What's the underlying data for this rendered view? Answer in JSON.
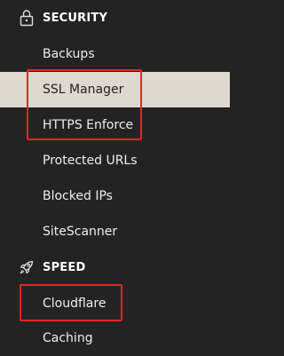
{
  "sidebar": {
    "sections": [
      {
        "title": "SECURITY",
        "icon": "lock-icon",
        "items": [
          {
            "label": "Backups",
            "active": false
          },
          {
            "label": "SSL Manager",
            "active": true
          },
          {
            "label": "HTTPS Enforce",
            "active": false
          },
          {
            "label": "Protected URLs",
            "active": false
          },
          {
            "label": "Blocked IPs",
            "active": false
          },
          {
            "label": "SiteScanner",
            "active": false
          }
        ]
      },
      {
        "title": "SPEED",
        "icon": "rocket-icon",
        "items": [
          {
            "label": "Cloudflare",
            "active": false
          },
          {
            "label": "Caching",
            "active": false
          }
        ]
      }
    ]
  },
  "annotations": {
    "highlight_color": "#e8251c",
    "highlighted_items": [
      "SSL Manager",
      "HTTPS Enforce",
      "Cloudflare"
    ]
  },
  "colors": {
    "background": "#232323",
    "active_background": "#ded8cf",
    "text": "#eeeeee",
    "active_text": "#222222"
  }
}
